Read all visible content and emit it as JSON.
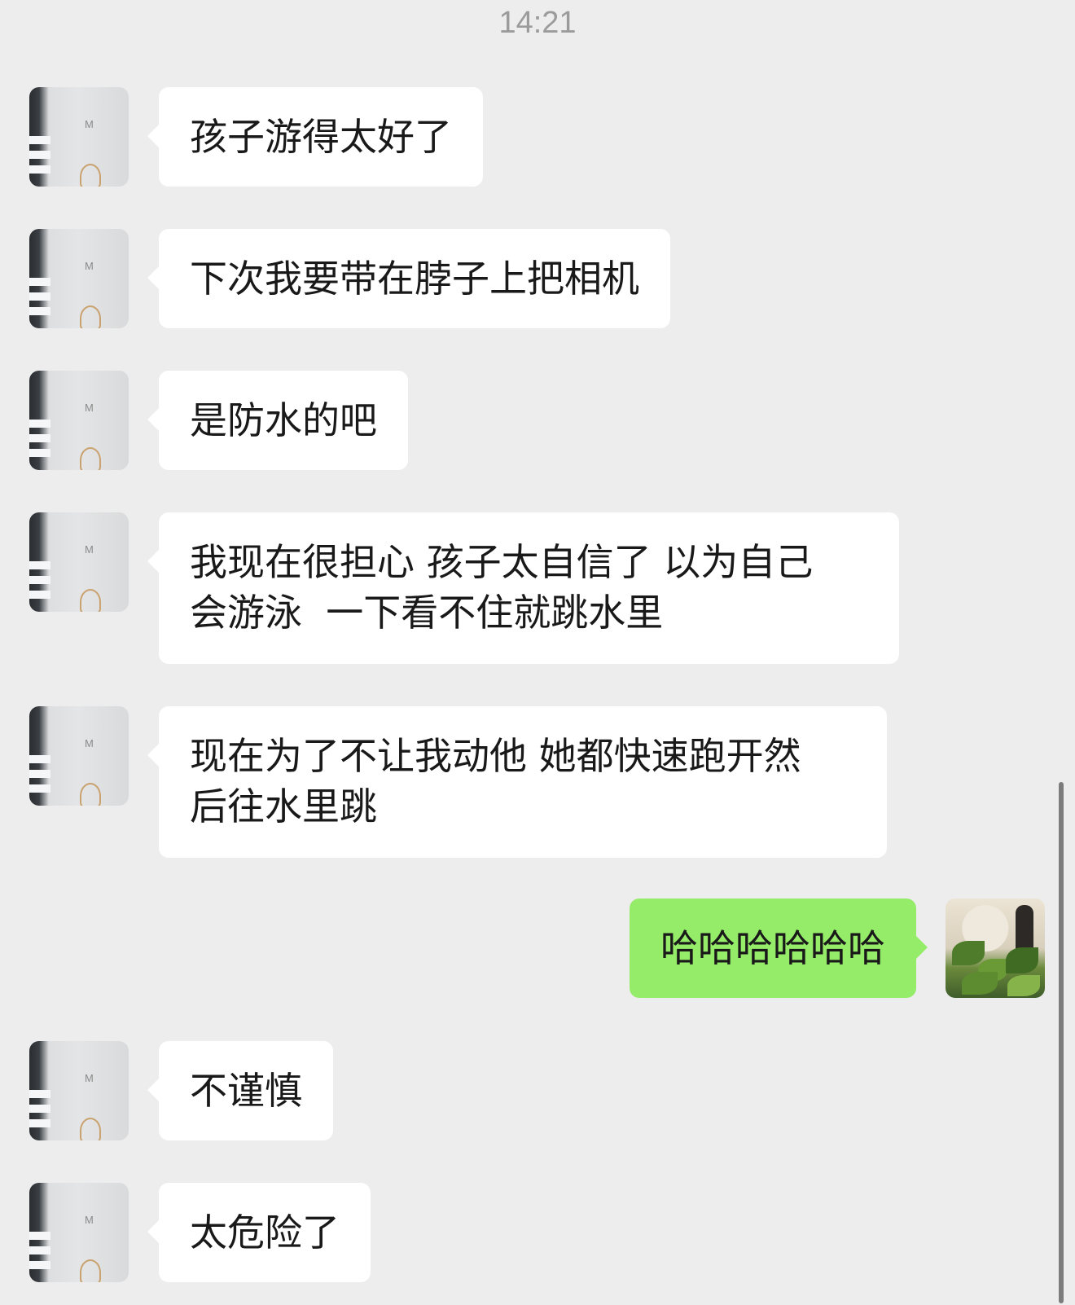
{
  "status": {
    "time": "14:21"
  },
  "messages": [
    {
      "from": "them",
      "text": "孩子游得太好了"
    },
    {
      "from": "them",
      "text": "下次我要带在脖子上把相机"
    },
    {
      "from": "them",
      "text": "是防水的吧"
    },
    {
      "from": "them",
      "text": "我现在很担心 孩子太自信了 以为自己\n会游泳  一下看不住就跳水里"
    },
    {
      "from": "them",
      "text": "现在为了不让我动他 她都快速跑开然\n后往水里跳"
    },
    {
      "from": "me",
      "text": "哈哈哈哈哈哈"
    },
    {
      "from": "them",
      "text": "不谨慎"
    },
    {
      "from": "them",
      "text": "太危险了"
    }
  ],
  "avatars": {
    "them": {
      "letter": "M"
    }
  },
  "colors": {
    "background": "#ededed",
    "bubble_them": "#ffffff",
    "bubble_me": "#95ec69",
    "timestamp": "#9b9b9b"
  }
}
